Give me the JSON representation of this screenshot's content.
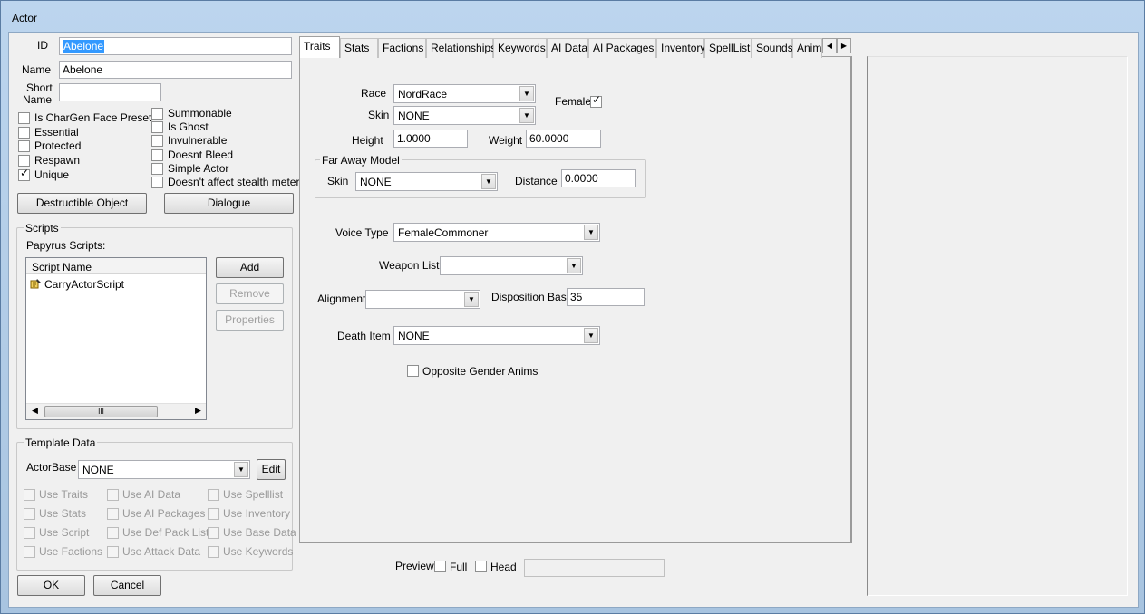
{
  "window": {
    "title": "Actor"
  },
  "left": {
    "id_label": "ID",
    "id_value": "Abelone",
    "name_label": "Name",
    "name_value": "Abelone",
    "short_name_label_1": "Short",
    "short_name_label_2": "Name",
    "short_name_value": "",
    "checks_col1": [
      {
        "label": "Is CharGen Face Preset",
        "checked": false
      },
      {
        "label": "Essential",
        "checked": false
      },
      {
        "label": "Protected",
        "checked": false
      },
      {
        "label": "Respawn",
        "checked": false
      },
      {
        "label": "Unique",
        "checked": true
      }
    ],
    "checks_col2": [
      {
        "label": "Summonable",
        "checked": false
      },
      {
        "label": "Is Ghost",
        "checked": false
      },
      {
        "label": "Invulnerable",
        "checked": false
      },
      {
        "label": "Doesnt Bleed",
        "checked": false
      },
      {
        "label": "Simple Actor",
        "checked": false
      },
      {
        "label": "Doesn't affect stealth meter",
        "checked": false
      }
    ],
    "destructible_button": "Destructible Object",
    "dialogue_button": "Dialogue"
  },
  "scripts": {
    "group_label": "Scripts",
    "papyrus_label": "Papyrus Scripts:",
    "column_header": "Script Name",
    "items": [
      {
        "name": "CarryActorScript",
        "icon": "script-icon"
      }
    ],
    "add_button": "Add",
    "remove_button": "Remove",
    "properties_button": "Properties",
    "scroll_grip": "III"
  },
  "template": {
    "group_label": "Template Data",
    "actorbase_label": "ActorBase",
    "actorbase_value": "NONE",
    "edit_button": "Edit",
    "uses": [
      "Use Traits",
      "Use AI Data",
      "Use Spelllist",
      "Use Stats",
      "Use AI Packages",
      "Use Inventory",
      "Use Script",
      "Use Def Pack List",
      "Use Base Data",
      "Use Factions",
      "Use Attack Data",
      "Use Keywords"
    ]
  },
  "footer": {
    "ok_button": "OK",
    "cancel_button": "Cancel",
    "preview_label": "Preview",
    "full_label": "Full",
    "head_label": "Head",
    "preview_value": ""
  },
  "tabs": [
    "Traits",
    "Stats",
    "Factions",
    "Relationships",
    "Keywords",
    "AI Data",
    "AI Packages",
    "Inventory",
    "SpellList",
    "Sounds",
    "Anim"
  ],
  "traits": {
    "race_label": "Race",
    "race_value": "NordRace",
    "female_label": "Female",
    "female_checked": true,
    "skin_label": "Skin",
    "skin_value": "NONE",
    "height_label": "Height",
    "height_value": "1.0000",
    "weight_label": "Weight",
    "weight_value": "60.0000",
    "faraway_label": "Far Away Model",
    "fa_skin_label": "Skin",
    "fa_skin_value": "NONE",
    "distance_label": "Distance",
    "distance_value": "0.0000",
    "voice_label": "Voice Type",
    "voice_value": "FemaleCommoner",
    "weapon_label": "Weapon List",
    "weapon_value": "",
    "alignment_label": "Alignment",
    "alignment_value": "",
    "disposition_label": "Disposition Base",
    "disposition_value": "35",
    "death_label": "Death Item",
    "death_value": "NONE",
    "opposite_label": "Opposite Gender Anims"
  }
}
